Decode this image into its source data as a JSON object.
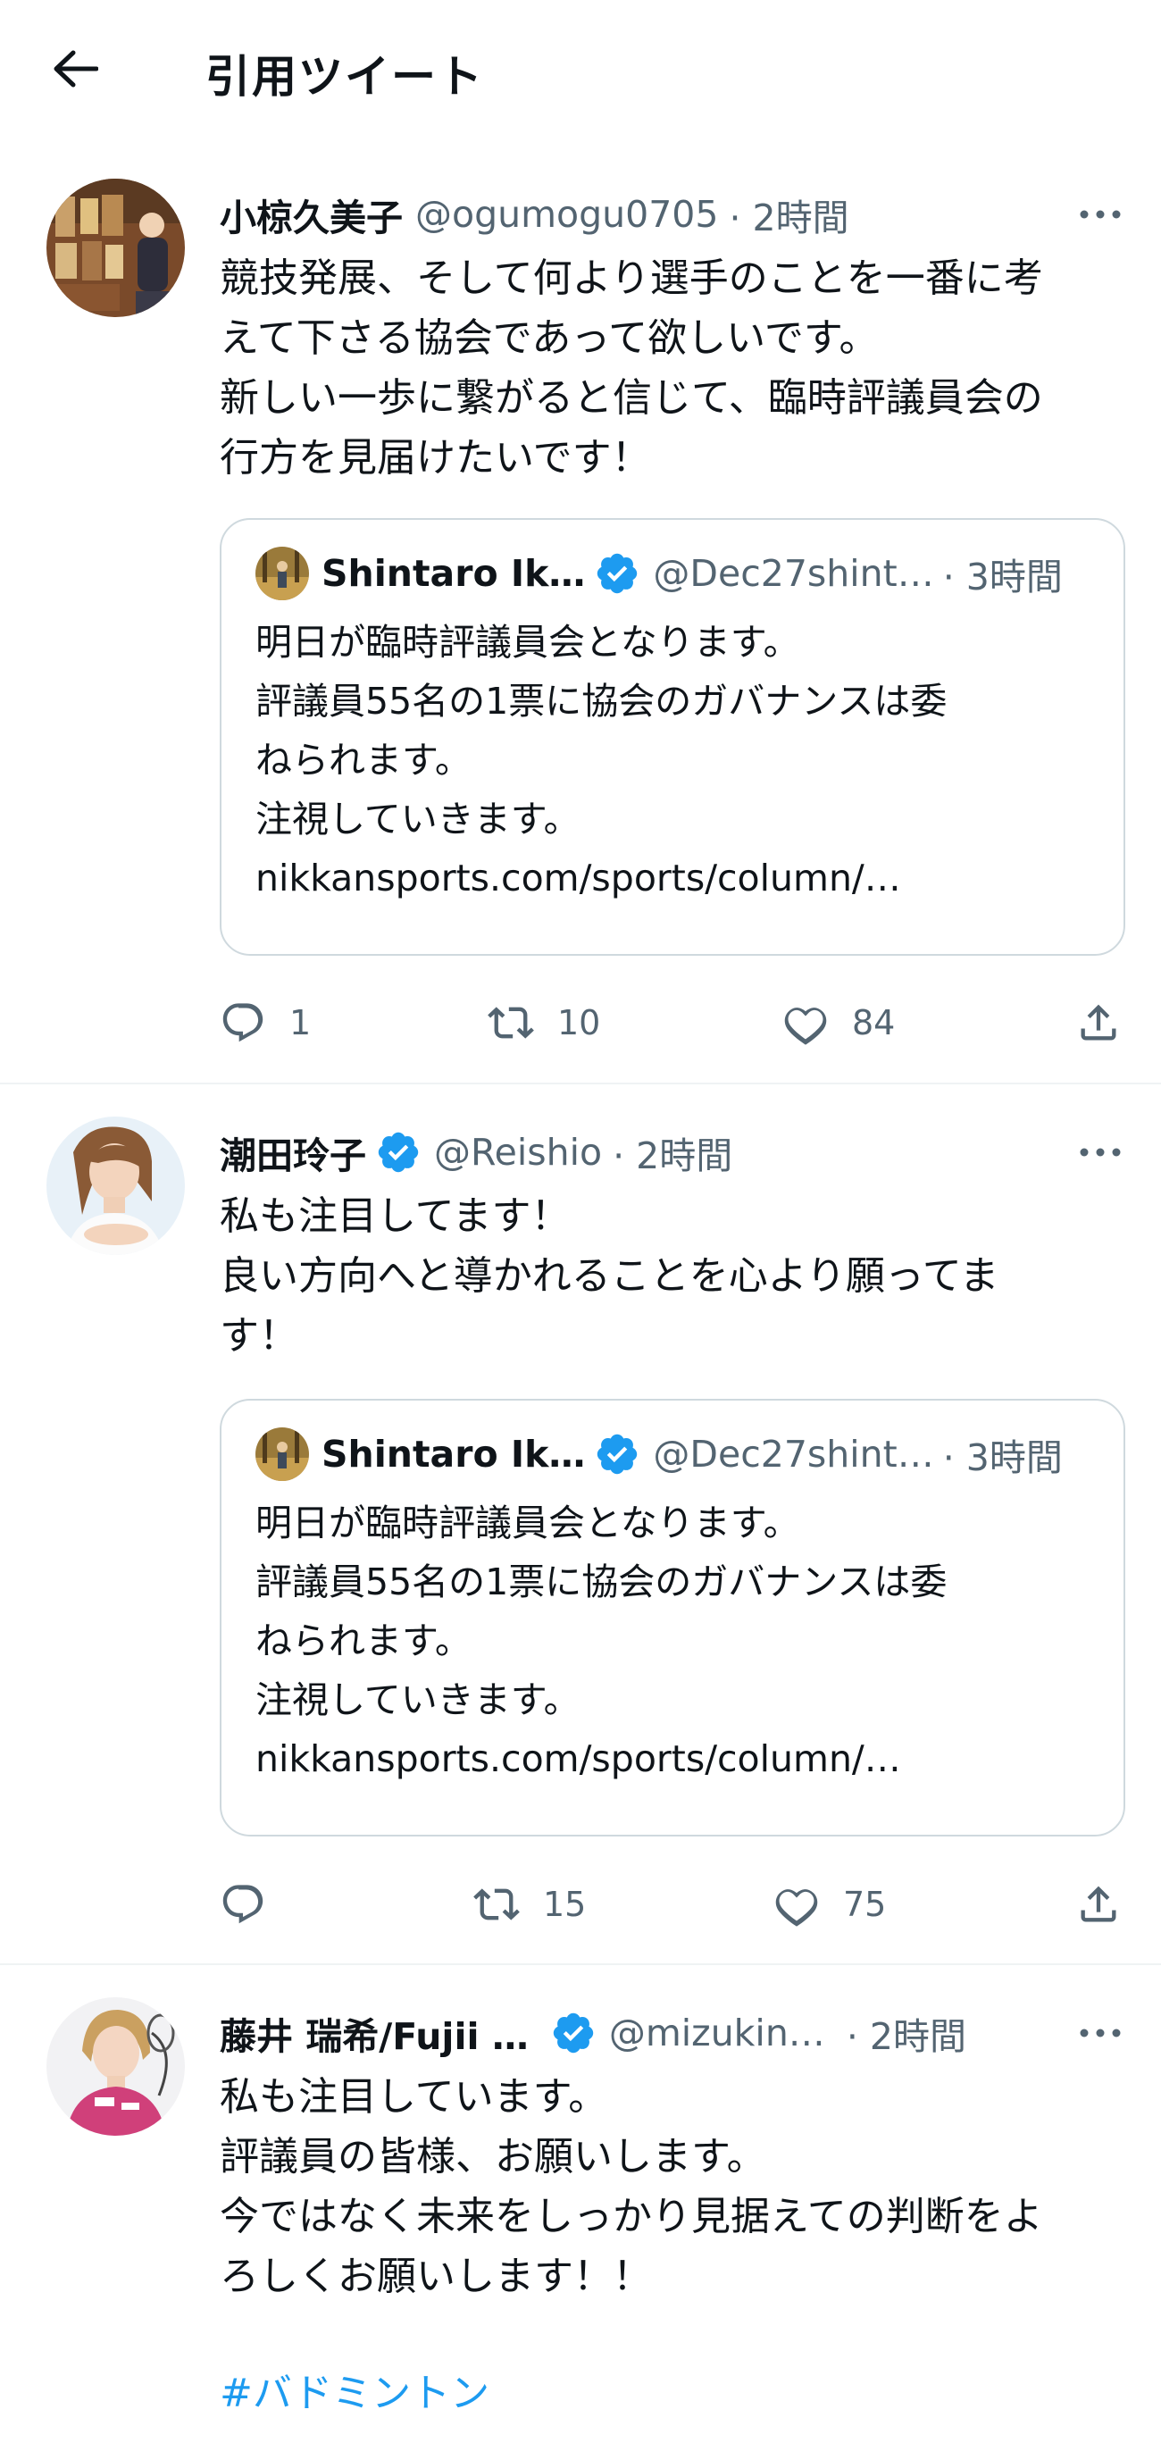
{
  "header": {
    "title": "引用ツイート"
  },
  "tweets": [
    {
      "name": "小椋久美子",
      "handle": "@ogumogu0705",
      "time": "· 2時間",
      "verified": false,
      "text": "競技発展、そして何より選手のことを一番に考\nえて下さる協会であって欲しいです。\n新しい一歩に繋がると信じて、臨時評議員会の\n行方を見届けたいです！",
      "quote": {
        "name": "Shintaro Ik…",
        "handle": "@Dec27shint…",
        "time": "· 3時間",
        "text": "明日が臨時評議員会となります。\n評議員55名の1票に協会のガバナンスは委\nねられます。\n注視していきます。\nnikkansports.com/sports/column/…"
      },
      "replies": "1",
      "retweets": "10",
      "likes": "84"
    },
    {
      "name": "潮田玲子",
      "handle": "@Reishio",
      "time": "· 2時間",
      "verified": true,
      "text": "私も注目してます！\n良い方向へと導かれることを心より願ってま\nす！",
      "quote": {
        "name": "Shintaro Ik…",
        "handle": "@Dec27shint…",
        "time": "· 3時間",
        "text": "明日が臨時評議員会となります。\n評議員55名の1票に協会のガバナンスは委\nねられます。\n注視していきます。\nnikkansports.com/sports/column/…"
      },
      "replies": "",
      "retweets": "15",
      "likes": "75"
    },
    {
      "name": "藤井 瑞希/Fujii …",
      "handle": "@mizukin…",
      "time": "· 2時間",
      "verified": true,
      "text": "私も注目しています。\n評議員の皆様、お願いします。\n今ではなく未来をしっかり見据えての判断をよ\nろしくお願いします！！",
      "hashtag": "#バドミントン"
    }
  ],
  "colors": {
    "accent": "#1d9bf0",
    "secondary_text": "#536471",
    "border": "#cfd9de"
  },
  "icons": [
    "back-arrow-icon",
    "more-icon",
    "verified-badge-icon",
    "reply-icon",
    "retweet-icon",
    "like-icon",
    "share-icon"
  ]
}
